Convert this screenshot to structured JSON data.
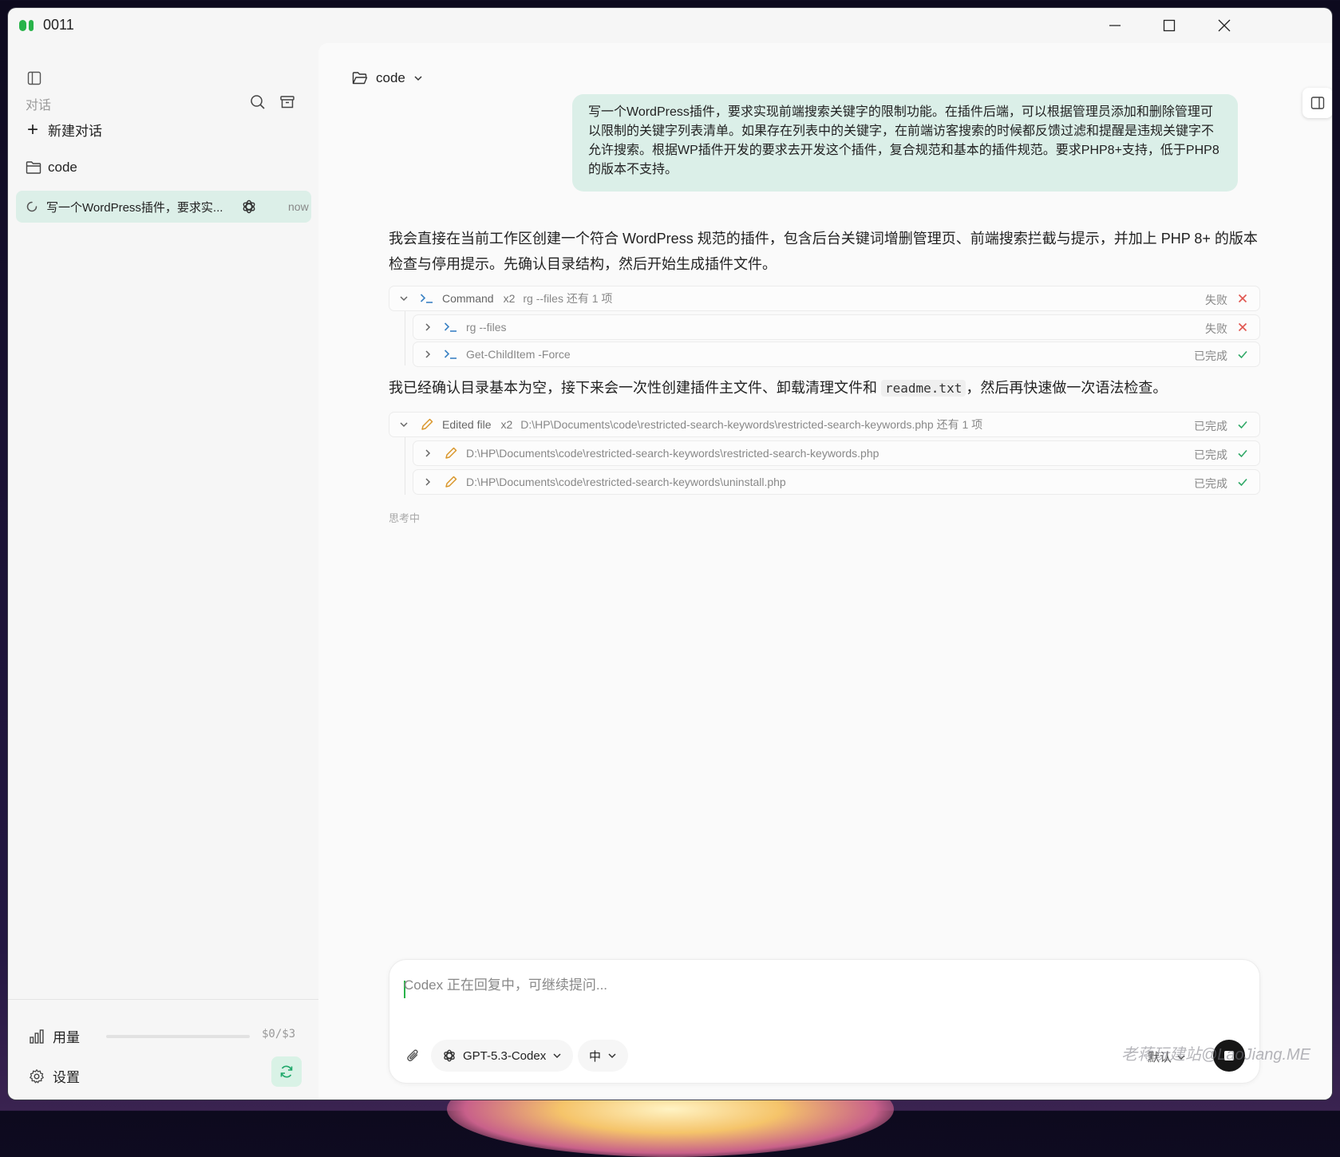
{
  "window": {
    "title": "0011",
    "controls": [
      "minimize-icon",
      "maximize-icon",
      "close-icon"
    ]
  },
  "sidebar": {
    "heading": "对话",
    "new_chat_label": "新建对话",
    "folder_label": "code",
    "conversation": {
      "title": "写一个WordPress插件，要求实...",
      "time": "now"
    },
    "usage_label": "用量",
    "usage_value": "$0/$3",
    "usage_fraction": 0,
    "settings_label": "设置"
  },
  "main": {
    "breadcrumb": "code",
    "user_message": "写一个WordPress插件，要求实现前端搜索关键字的限制功能。在插件后端，可以根据管理员添加和删除管理可以限制的关键字列表清单。如果存在列表中的关键字，在前端访客搜索的时候都反馈过滤和提醒是违规关键字不允许搜索。根据WP插件开发的要求去开发这个插件，复合规范和基本的插件规范。要求PHP8+支持，低于PHP8的版本不支持。",
    "ai_text_1": "我会直接在当前工作区创建一个符合 WordPress 规范的插件，包含后台关键词增删管理页、前端搜索拦截与提示，并加上 PHP 8+ 的版本检查与停用提示。先确认目录结构，然后开始生成插件文件。",
    "command_group": {
      "label": "Command",
      "count": "x2",
      "detail": "rg --files 还有 1 项",
      "status": "失败",
      "items": [
        {
          "label": "rg --files",
          "status": "失败"
        },
        {
          "label": "Get-ChildItem -Force",
          "status": "已完成"
        }
      ]
    },
    "ai_text_2_pre": "我已经确认目录基本为空，接下来会一次性创建插件主文件、卸载清理文件和 ",
    "ai_text_2_code": "readme.txt",
    "ai_text_2_post": "，然后再快速做一次语法检查。",
    "edit_group": {
      "label": "Edited file",
      "count": "x2",
      "detail": "D:\\HP\\Documents\\code\\restricted-search-keywords\\restricted-search-keywords.php 还有 1 项",
      "status": "已完成",
      "items": [
        {
          "label": "D:\\HP\\Documents\\code\\restricted-search-keywords\\restricted-search-keywords.php",
          "status": "已完成"
        },
        {
          "label": "D:\\HP\\Documents\\code\\restricted-search-keywords\\uninstall.php",
          "status": "已完成"
        }
      ]
    },
    "thinking": "思考中"
  },
  "composer": {
    "placeholder": "Codex 正在回复中，可继续提问...",
    "model": "GPT-5.3-Codex",
    "effort": "中",
    "mode": "默认"
  },
  "watermark": "老蒋玩建站@LaoJiang.ME",
  "colors": {
    "accent_green": "#28b34a",
    "active_item_bg": "#dcefe8",
    "user_bubble_bg": "#dbefe8",
    "fail_red": "#e0554f",
    "success_green": "#2fa866",
    "command_icon_blue": "#3b82c4",
    "edit_icon_orange": "#d9962a"
  }
}
